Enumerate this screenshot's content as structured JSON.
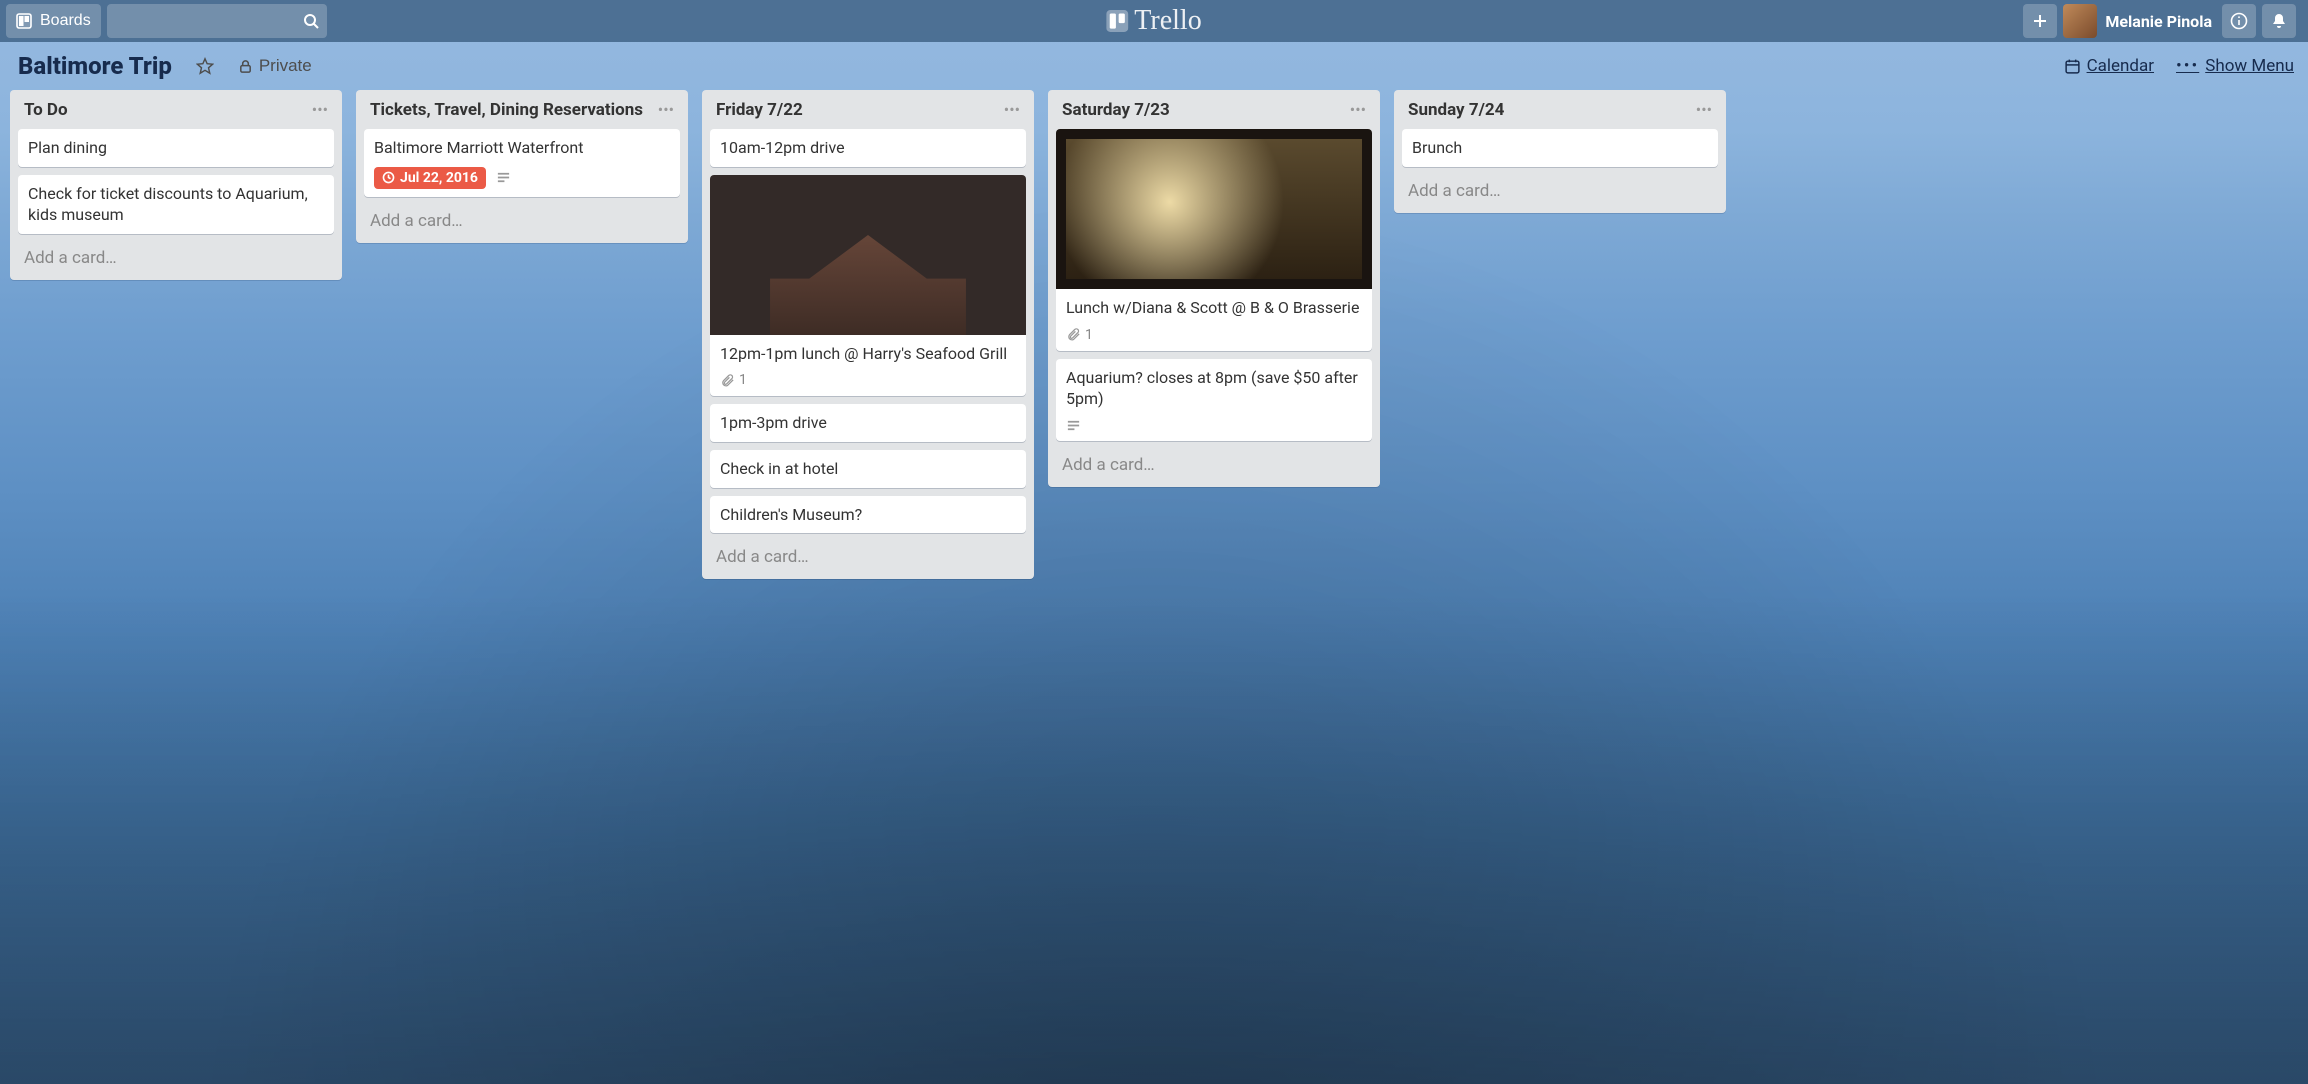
{
  "header": {
    "boards_label": "Boards",
    "logo_text": "Trello",
    "username": "Melanie Pinola"
  },
  "board_header": {
    "title": "Baltimore Trip",
    "privacy_label": "Private",
    "calendar_label": "Calendar",
    "show_menu_label": "Show Menu"
  },
  "common": {
    "add_card_label": "Add a card…"
  },
  "lists": [
    {
      "title": "To Do",
      "cards": [
        {
          "text": "Plan dining"
        },
        {
          "text": "Check for ticket discounts to Aquarium, kids museum"
        }
      ]
    },
    {
      "title": "Tickets, Travel, Dining Reservations",
      "cards": [
        {
          "text": "Baltimore Marriott Waterfront",
          "due": "Jul 22, 2016",
          "has_description": true
        }
      ]
    },
    {
      "title": "Friday 7/22",
      "cards": [
        {
          "text": "10am-12pm drive"
        },
        {
          "text": "12pm-1pm lunch @ Harry's Seafood Grill",
          "cover": "building",
          "attachments": 1
        },
        {
          "text": "1pm-3pm drive"
        },
        {
          "text": "Check in at hotel"
        },
        {
          "text": "Children's Museum?"
        }
      ]
    },
    {
      "title": "Saturday 7/23",
      "cards": [
        {
          "text": "Lunch w/Diana & Scott @ B & O Brasserie",
          "cover": "poster",
          "attachments": 1
        },
        {
          "text": "Aquarium? closes at 8pm (save $50 after 5pm)",
          "has_description": true
        }
      ]
    },
    {
      "title": "Sunday 7/24",
      "cards": [
        {
          "text": "Brunch"
        }
      ]
    }
  ]
}
